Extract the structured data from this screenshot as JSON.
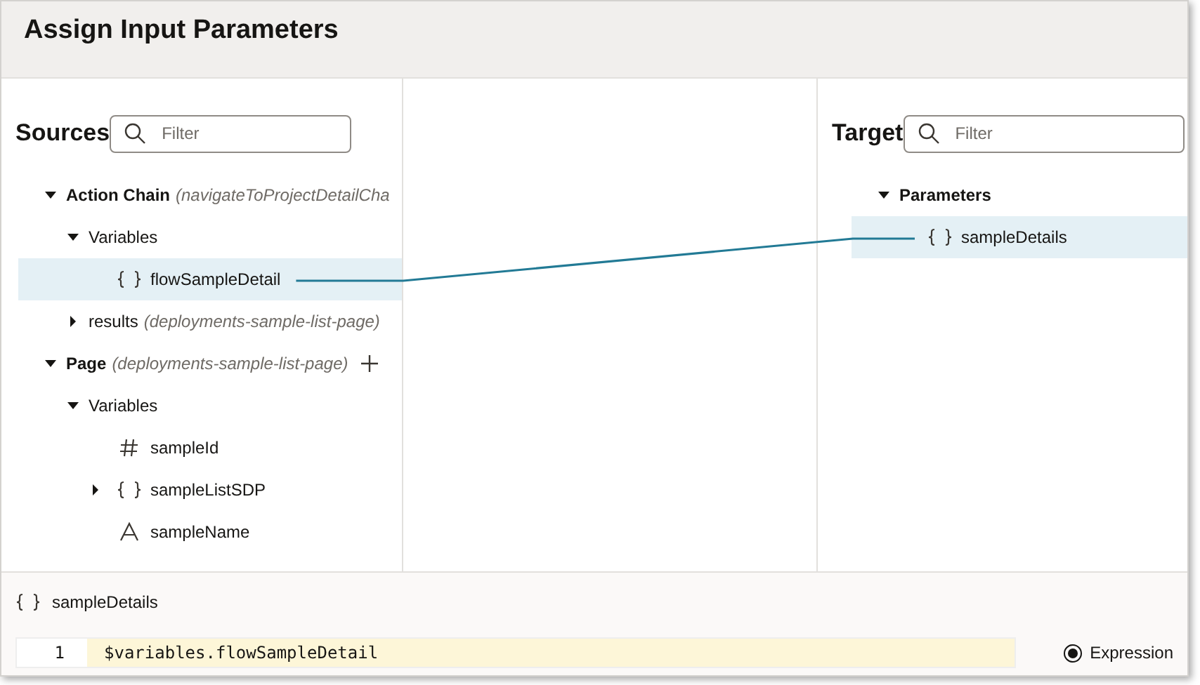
{
  "dialog": {
    "title": "Assign Input Parameters"
  },
  "sources": {
    "heading": "Sources",
    "filter": {
      "placeholder": "Filter"
    },
    "tree": [
      {
        "kind": "group",
        "label": "Action Chain",
        "detail": "(navigateToProjectDetailCha",
        "expanded": true,
        "children": [
          {
            "kind": "folder",
            "label": "Variables",
            "expanded": true,
            "children": [
              {
                "kind": "object",
                "label": "flowSampleDetail",
                "selected": true
              }
            ]
          },
          {
            "kind": "folder",
            "label": "results",
            "detail": "(deployments-sample-list-page)",
            "expanded": false
          }
        ]
      },
      {
        "kind": "group",
        "label": "Page",
        "detail": "(deployments-sample-list-page)",
        "expanded": true,
        "addable": true,
        "children": [
          {
            "kind": "folder",
            "label": "Variables",
            "expanded": true,
            "children": [
              {
                "kind": "number",
                "label": "sampleId",
                "selected": false
              },
              {
                "kind": "object",
                "label": "sampleListSDP",
                "expanded": false,
                "selected": false
              },
              {
                "kind": "string",
                "label": "sampleName",
                "selected": false
              }
            ]
          }
        ]
      }
    ]
  },
  "target": {
    "heading": "Target",
    "filter": {
      "placeholder": "Filter"
    },
    "tree": [
      {
        "kind": "group",
        "label": "Parameters",
        "expanded": true,
        "children": [
          {
            "kind": "object",
            "label": "sampleDetails",
            "selected": true
          }
        ]
      }
    ]
  },
  "mapping": {
    "kind": "object",
    "label": "sampleDetails",
    "line_number": "1",
    "code": "$variables.flowSampleDetail",
    "mode": {
      "label": "Expression",
      "selected": true
    }
  }
}
